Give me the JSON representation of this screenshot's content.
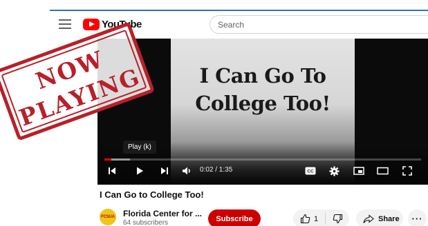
{
  "app": {
    "logo_text": "YouTube",
    "brand_color": "#ff0000"
  },
  "search": {
    "placeholder": "Search"
  },
  "overlay": {
    "stamp_line1": "NOW",
    "stamp_line2": "PLAYING",
    "stamp_color": "#b8202a"
  },
  "player": {
    "frame_title_line1": "I Can Go To",
    "frame_title_line2": "College Too!",
    "tooltip": "Play (k)",
    "time_display": "0:02 / 1:35",
    "progress_fraction": 0.021,
    "buffered_fraction": 0.08,
    "controls": {
      "previous_icon": "previous-icon",
      "play_icon": "play-icon",
      "next_icon": "next-icon",
      "volume_icon": "volume-icon",
      "captions_icon": "cc-icon",
      "settings_icon": "gear-icon",
      "miniplayer_icon": "miniplayer-icon",
      "theater_icon": "theater-icon",
      "fullscreen_icon": "fullscreen-icon"
    }
  },
  "video": {
    "title": "I Can Go to College Too!"
  },
  "channel": {
    "avatar_text": "FCSUA",
    "name": "Florida Center for ...",
    "subscribers": "64 subscribers"
  },
  "actions": {
    "subscribe_label": "Subscribe",
    "like_count": "1",
    "share_label": "Share",
    "more_label": "···"
  }
}
